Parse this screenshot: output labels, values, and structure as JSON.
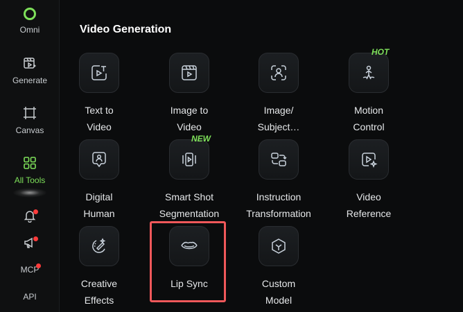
{
  "sidebar": {
    "items": [
      {
        "label": "Omni",
        "icon": "omni-ring-icon"
      },
      {
        "label": "Generate",
        "icon": "generate-icon"
      },
      {
        "label": "Canvas",
        "icon": "canvas-icon"
      },
      {
        "label": "All Tools",
        "icon": "grid-icon",
        "active": true
      }
    ],
    "bottom": {
      "notifications_icon": "bell-icon",
      "announcements_icon": "megaphone-icon",
      "mcp_label": "MCP",
      "api_label": "API"
    }
  },
  "main": {
    "section_title": "Video Generation",
    "tools": [
      {
        "line1": "Text to",
        "line2": "Video",
        "icon": "text-to-video-icon"
      },
      {
        "line1": "Image to",
        "line2": "Video",
        "icon": "image-to-video-icon"
      },
      {
        "line1": "Image/",
        "line2": "Subject…",
        "icon": "subject-icon"
      },
      {
        "line1": "Motion",
        "line2": "Control",
        "icon": "motion-control-icon",
        "tag": "HOT"
      },
      {
        "line1": "Digital",
        "line2": "Human",
        "icon": "digital-human-icon"
      },
      {
        "line1": "Smart Shot",
        "line2": "Segmentation",
        "icon": "smart-shot-icon",
        "tag": "NEW"
      },
      {
        "line1": "Instruction",
        "line2": "Transformation",
        "icon": "instruction-icon"
      },
      {
        "line1": "Video",
        "line2": "Reference",
        "icon": "video-reference-icon"
      },
      {
        "line1": "Creative",
        "line2": "Effects",
        "icon": "creative-effects-icon"
      },
      {
        "line1": "Lip Sync",
        "line2": "",
        "icon": "lips-icon",
        "highlighted": true
      },
      {
        "line1": "Custom",
        "line2": "Model",
        "icon": "custom-model-icon"
      }
    ]
  },
  "colors": {
    "accent": "#7ee05a",
    "highlight": "#f0585a",
    "badge": "#ff3b3b"
  }
}
